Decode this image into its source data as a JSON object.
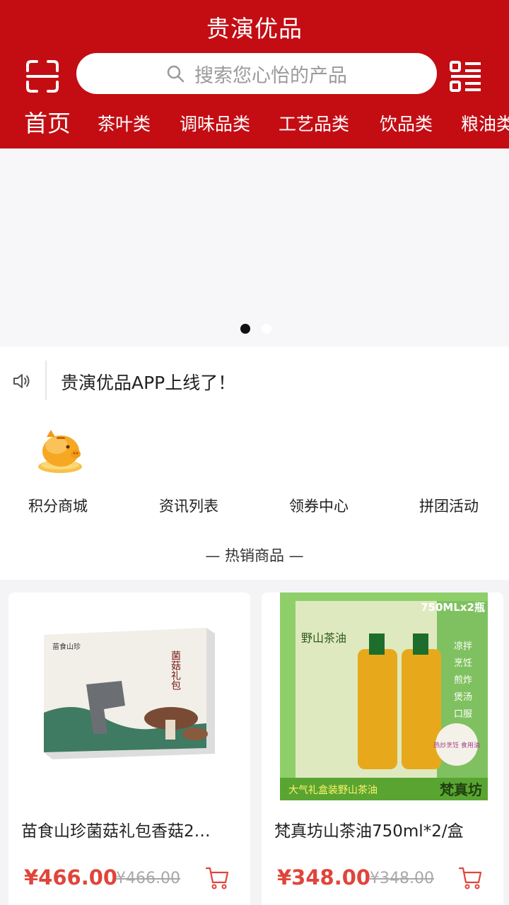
{
  "header": {
    "title": "贵演优品",
    "search_placeholder": "搜索您心怡的产品",
    "categories": [
      "首页",
      "茶叶类",
      "调味品类",
      "工艺品类",
      "饮品类",
      "粮油类"
    ]
  },
  "notice": {
    "text": "贵演优品APP上线了！"
  },
  "quick_nav": [
    {
      "label": "积分商城",
      "icon": "piggy-bank-icon"
    },
    {
      "label": "资讯列表",
      "icon": ""
    },
    {
      "label": "领券中心",
      "icon": ""
    },
    {
      "label": "拼团活动",
      "icon": ""
    }
  ],
  "section_title": "— 热销商品 —",
  "products": [
    {
      "name": "苗食山珍菌菇礼包香菇2…",
      "price": "¥466.00",
      "original_price": "¥466.00",
      "image_text": [
        "苗食山珍",
        "菌菇礼包"
      ]
    },
    {
      "name": "梵真坊山茶油750ml*2/盒",
      "price": "¥348.00",
      "original_price": "¥348.00",
      "image_text": [
        "750MLx2瓶",
        "野山茶油",
        "凉拌",
        "烹饪",
        "煎炸",
        "煲汤",
        "口服",
        "热炒烹饪 食用油",
        "大气礼盒装野山茶油",
        "梵真坊"
      ]
    }
  ],
  "colors": {
    "brand": "#c30d13",
    "price": "#e0453a"
  }
}
